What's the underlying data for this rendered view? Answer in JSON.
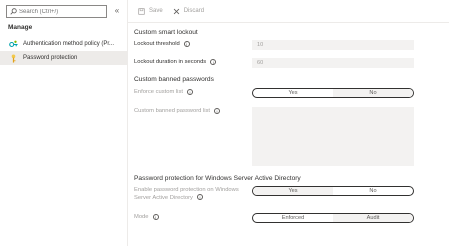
{
  "sidebar": {
    "search_placeholder": "Search (Ctrl+/)",
    "collapse_glyph": "«",
    "manage_header": "Manage",
    "items": [
      {
        "label": "Authentication method policy (Pr...",
        "icon": "key-icon",
        "icon_color": "#00a2ad"
      },
      {
        "label": "Password protection",
        "icon": "password-key-icon",
        "icon_color": "#f2c94c",
        "selected": true
      }
    ]
  },
  "toolbar": {
    "save_label": "Save",
    "discard_label": "Discard"
  },
  "smart_lockout": {
    "title": "Custom smart lockout",
    "threshold_label": "Lockout threshold",
    "threshold_value": "10",
    "duration_label": "Lockout duration in seconds",
    "duration_value": "60"
  },
  "banned_passwords": {
    "title": "Custom banned passwords",
    "enforce_label": "Enforce custom list",
    "enforce_options": [
      "Yes",
      "No"
    ],
    "enforce_selected": "No",
    "list_label": "Custom banned password list"
  },
  "windows_ad": {
    "title": "Password protection for Windows Server Active Directory",
    "enable_label_line1": "Enable password protection on Windows",
    "enable_label_line2": "Server Active Directory",
    "enable_options": [
      "Yes",
      "No"
    ],
    "enable_selected": "Yes",
    "mode_label": "Mode",
    "mode_options": [
      "Enforced",
      "Audit"
    ],
    "mode_selected": "Audit"
  },
  "colors": {
    "selected_nav_bg": "#edebe9",
    "disabled_field_bg": "#f3f2f1",
    "disabled_text": "#a19f9d"
  }
}
